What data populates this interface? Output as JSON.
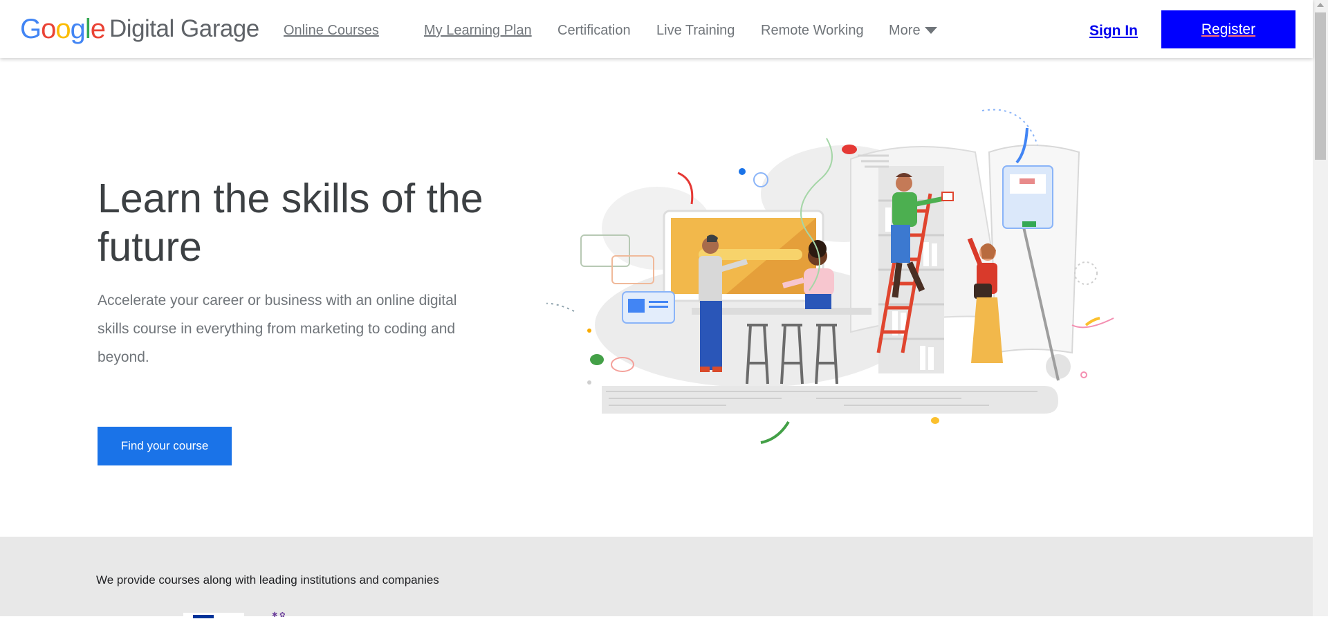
{
  "header": {
    "logo": {
      "google": [
        "G",
        "o",
        "o",
        "g",
        "l",
        "e"
      ],
      "google_colors": [
        "#4285F4",
        "#EA4335",
        "#FBBC05",
        "#4285F4",
        "#34A853",
        "#EA4335"
      ],
      "product": "Digital Garage"
    },
    "nav": [
      {
        "label": "Online Courses",
        "style": "link"
      },
      {
        "label": "My Learning Plan",
        "style": "link"
      },
      {
        "label": "Certification",
        "style": "plain"
      },
      {
        "label": "Live Training",
        "style": "plain"
      },
      {
        "label": "Remote Working",
        "style": "plain"
      },
      {
        "label": "More",
        "style": "dropdown",
        "icon": "caret-down-icon"
      }
    ],
    "sign_in": "Sign In",
    "register": "Register"
  },
  "hero": {
    "title": "Learn the skills of the future",
    "subtitle": "Accelerate your career or business with an online digital skills course in everything from marketing to coding and beyond.",
    "cta": "Find your course"
  },
  "partners": {
    "text": "We provide courses along with leading institutions and companies"
  },
  "colors": {
    "register_bg": "#0000ff",
    "cta_bg": "#1a73e8",
    "partners_bg": "#e8e8e8",
    "title": "#3c4043",
    "muted": "#70757a"
  }
}
